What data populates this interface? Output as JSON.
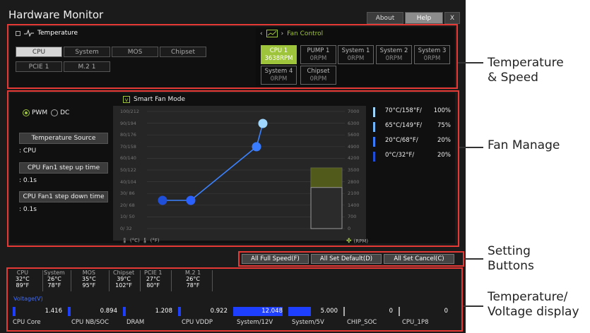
{
  "app": {
    "title": "Hardware Monitor",
    "about": "About",
    "help": "Help",
    "close": "X"
  },
  "temperature": {
    "label": "Temperature",
    "sources": [
      "CPU",
      "System",
      "MOS",
      "Chipset",
      "PCIE 1",
      "M.2 1"
    ],
    "selected": "CPU"
  },
  "fan_control": {
    "label": "Fan Control",
    "fans": [
      {
        "name": "CPU 1",
        "rpm": "3638RPM"
      },
      {
        "name": "PUMP 1",
        "rpm": "0RPM"
      },
      {
        "name": "System 1",
        "rpm": "0RPM"
      },
      {
        "name": "System 2",
        "rpm": "0RPM"
      },
      {
        "name": "System 3",
        "rpm": "0RPM"
      },
      {
        "name": "System 4",
        "rpm": "0RPM"
      },
      {
        "name": "Chipset",
        "rpm": "0RPM"
      }
    ],
    "selected": "CPU 1"
  },
  "fan_manage": {
    "pwm": "PWM",
    "dc": "DC",
    "mode_selected": "PWM",
    "temp_source_button": "Temperature Source",
    "temp_source_value": ": CPU",
    "step_up_button": "CPU Fan1 step up time",
    "step_up_value": ": 0.1s",
    "step_down_button": "CPU Fan1 step down time",
    "step_down_value": ": 0.1s",
    "smart_fan_mode": "Smart Fan Mode",
    "smart_fan_checked": true,
    "celsius_label": "(°C)",
    "fahrenheit_label": "(°F)",
    "rpm_label": "(RPM)"
  },
  "chart_data": {
    "type": "line",
    "x_axis_labels": [
      "0/ 32",
      "10/ 50",
      "20/ 68",
      "30/ 86",
      "40/104",
      "50/122",
      "60/140",
      "70/158",
      "80/176",
      "90/194",
      "100/212"
    ],
    "rpm_axis_labels": [
      "0",
      "700",
      "1400",
      "2100",
      "2800",
      "3500",
      "4200",
      "4900",
      "5600",
      "6300",
      "7000"
    ],
    "series": [
      {
        "x": [
          0,
          0
        ],
        "y": [
          20,
          20
        ]
      }
    ],
    "points": [
      {
        "temp_c": 0,
        "percent": 20
      },
      {
        "temp_c": 20,
        "percent": 20
      },
      {
        "temp_c": 65,
        "percent": 75
      },
      {
        "temp_c": 70,
        "percent": 100
      }
    ],
    "current_rpm": 3638,
    "right_table": [
      {
        "temp": "70°C/158°F/",
        "percent": "100%",
        "color": "#9fd6ff"
      },
      {
        "temp": "65°C/149°F/",
        "percent": "75%",
        "color": "#6fb6ff"
      },
      {
        "temp": "20°C/68°F/",
        "percent": "20%",
        "color": "#3a7cff"
      },
      {
        "temp": "0°C/32°F/",
        "percent": "20%",
        "color": "#1f4fd8"
      }
    ]
  },
  "settings": {
    "full_speed": "All Full Speed(F)",
    "set_default": "All Set Default(D)",
    "set_cancel": "All Set Cancel(C)"
  },
  "temp_monitor": [
    {
      "name": "CPU",
      "c": "32°C",
      "f": "89°F"
    },
    {
      "name": "System",
      "c": "26°C",
      "f": "78°F"
    },
    {
      "name": "MOS",
      "c": "35°C",
      "f": "95°F"
    },
    {
      "name": "Chipset",
      "c": "39°C",
      "f": "102°F"
    },
    {
      "name": "PCIE 1",
      "c": "27°C",
      "f": "80°F"
    },
    {
      "name": "M.2 1",
      "c": "26°C",
      "f": "78°F"
    }
  ],
  "voltage": {
    "label": "Voltage(V)",
    "items": [
      {
        "name": "CPU Core",
        "value": "1.416",
        "fill": 0.05
      },
      {
        "name": "CPU NB/SOC",
        "value": "0.894",
        "fill": 0.05
      },
      {
        "name": "DRAM",
        "value": "1.208",
        "fill": 0.05
      },
      {
        "name": "CPU VDDP",
        "value": "0.922",
        "fill": 0.05
      },
      {
        "name": "System/12V",
        "value": "12.048",
        "fill": 1.0
      },
      {
        "name": "System/5V",
        "value": "5.000",
        "fill": 0.45
      },
      {
        "name": "CHIP_SOC",
        "value": "0",
        "fill": 0
      },
      {
        "name": "CPU_1P8",
        "value": "0",
        "fill": 0
      }
    ]
  },
  "callouts": {
    "temp_speed_1": "Temperature",
    "temp_speed_2": "& Speed",
    "fan_manage": "Fan Manage",
    "setting_1": "Setting",
    "setting_2": "Buttons",
    "temp_volt_1": "Temperature/",
    "temp_volt_2": "Voltage display"
  }
}
